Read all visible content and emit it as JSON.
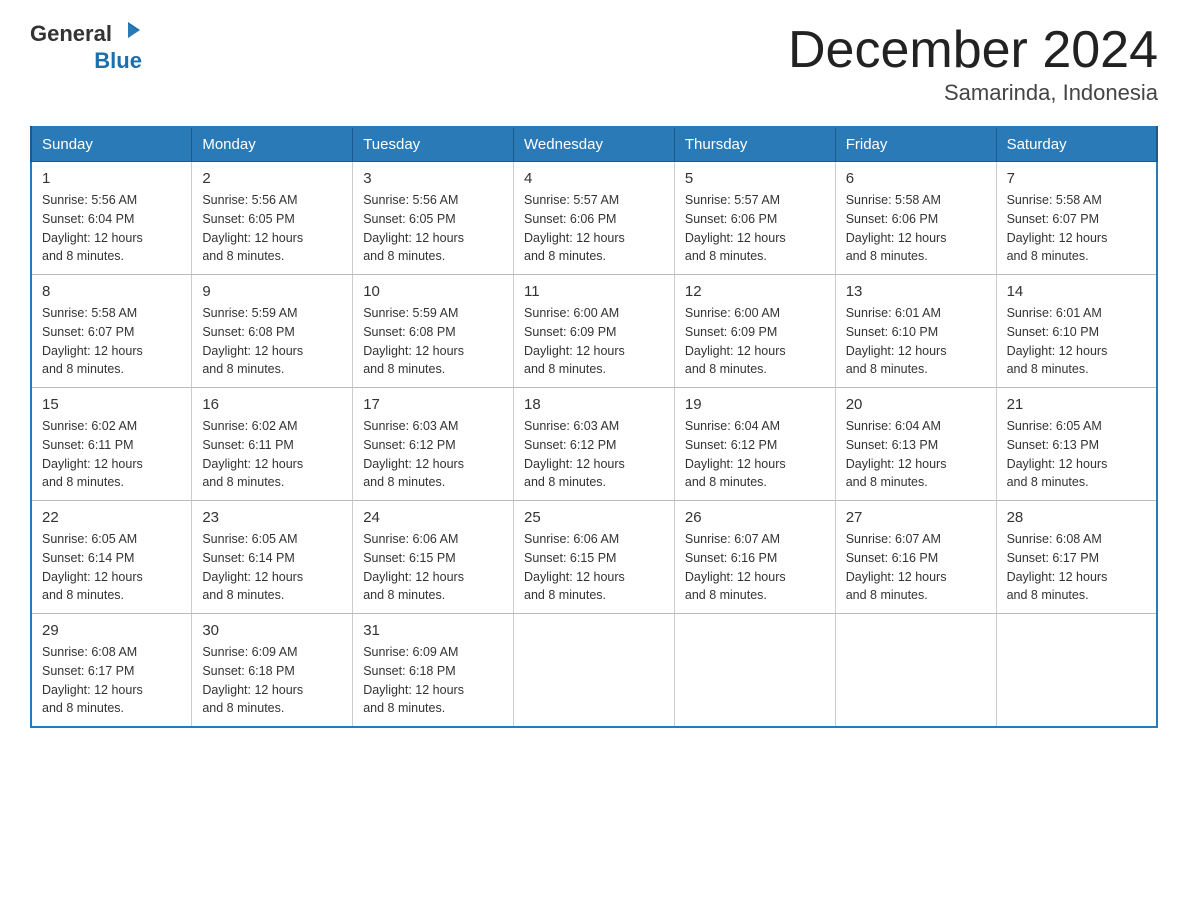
{
  "header": {
    "logo_general": "General",
    "logo_blue": "Blue",
    "title": "December 2024",
    "location": "Samarinda, Indonesia"
  },
  "days_of_week": [
    "Sunday",
    "Monday",
    "Tuesday",
    "Wednesday",
    "Thursday",
    "Friday",
    "Saturday"
  ],
  "weeks": [
    [
      {
        "num": "1",
        "sunrise": "5:56 AM",
        "sunset": "6:04 PM",
        "daylight": "12 hours and 8 minutes."
      },
      {
        "num": "2",
        "sunrise": "5:56 AM",
        "sunset": "6:05 PM",
        "daylight": "12 hours and 8 minutes."
      },
      {
        "num": "3",
        "sunrise": "5:56 AM",
        "sunset": "6:05 PM",
        "daylight": "12 hours and 8 minutes."
      },
      {
        "num": "4",
        "sunrise": "5:57 AM",
        "sunset": "6:06 PM",
        "daylight": "12 hours and 8 minutes."
      },
      {
        "num": "5",
        "sunrise": "5:57 AM",
        "sunset": "6:06 PM",
        "daylight": "12 hours and 8 minutes."
      },
      {
        "num": "6",
        "sunrise": "5:58 AM",
        "sunset": "6:06 PM",
        "daylight": "12 hours and 8 minutes."
      },
      {
        "num": "7",
        "sunrise": "5:58 AM",
        "sunset": "6:07 PM",
        "daylight": "12 hours and 8 minutes."
      }
    ],
    [
      {
        "num": "8",
        "sunrise": "5:58 AM",
        "sunset": "6:07 PM",
        "daylight": "12 hours and 8 minutes."
      },
      {
        "num": "9",
        "sunrise": "5:59 AM",
        "sunset": "6:08 PM",
        "daylight": "12 hours and 8 minutes."
      },
      {
        "num": "10",
        "sunrise": "5:59 AM",
        "sunset": "6:08 PM",
        "daylight": "12 hours and 8 minutes."
      },
      {
        "num": "11",
        "sunrise": "6:00 AM",
        "sunset": "6:09 PM",
        "daylight": "12 hours and 8 minutes."
      },
      {
        "num": "12",
        "sunrise": "6:00 AM",
        "sunset": "6:09 PM",
        "daylight": "12 hours and 8 minutes."
      },
      {
        "num": "13",
        "sunrise": "6:01 AM",
        "sunset": "6:10 PM",
        "daylight": "12 hours and 8 minutes."
      },
      {
        "num": "14",
        "sunrise": "6:01 AM",
        "sunset": "6:10 PM",
        "daylight": "12 hours and 8 minutes."
      }
    ],
    [
      {
        "num": "15",
        "sunrise": "6:02 AM",
        "sunset": "6:11 PM",
        "daylight": "12 hours and 8 minutes."
      },
      {
        "num": "16",
        "sunrise": "6:02 AM",
        "sunset": "6:11 PM",
        "daylight": "12 hours and 8 minutes."
      },
      {
        "num": "17",
        "sunrise": "6:03 AM",
        "sunset": "6:12 PM",
        "daylight": "12 hours and 8 minutes."
      },
      {
        "num": "18",
        "sunrise": "6:03 AM",
        "sunset": "6:12 PM",
        "daylight": "12 hours and 8 minutes."
      },
      {
        "num": "19",
        "sunrise": "6:04 AM",
        "sunset": "6:12 PM",
        "daylight": "12 hours and 8 minutes."
      },
      {
        "num": "20",
        "sunrise": "6:04 AM",
        "sunset": "6:13 PM",
        "daylight": "12 hours and 8 minutes."
      },
      {
        "num": "21",
        "sunrise": "6:05 AM",
        "sunset": "6:13 PM",
        "daylight": "12 hours and 8 minutes."
      }
    ],
    [
      {
        "num": "22",
        "sunrise": "6:05 AM",
        "sunset": "6:14 PM",
        "daylight": "12 hours and 8 minutes."
      },
      {
        "num": "23",
        "sunrise": "6:05 AM",
        "sunset": "6:14 PM",
        "daylight": "12 hours and 8 minutes."
      },
      {
        "num": "24",
        "sunrise": "6:06 AM",
        "sunset": "6:15 PM",
        "daylight": "12 hours and 8 minutes."
      },
      {
        "num": "25",
        "sunrise": "6:06 AM",
        "sunset": "6:15 PM",
        "daylight": "12 hours and 8 minutes."
      },
      {
        "num": "26",
        "sunrise": "6:07 AM",
        "sunset": "6:16 PM",
        "daylight": "12 hours and 8 minutes."
      },
      {
        "num": "27",
        "sunrise": "6:07 AM",
        "sunset": "6:16 PM",
        "daylight": "12 hours and 8 minutes."
      },
      {
        "num": "28",
        "sunrise": "6:08 AM",
        "sunset": "6:17 PM",
        "daylight": "12 hours and 8 minutes."
      }
    ],
    [
      {
        "num": "29",
        "sunrise": "6:08 AM",
        "sunset": "6:17 PM",
        "daylight": "12 hours and 8 minutes."
      },
      {
        "num": "30",
        "sunrise": "6:09 AM",
        "sunset": "6:18 PM",
        "daylight": "12 hours and 8 minutes."
      },
      {
        "num": "31",
        "sunrise": "6:09 AM",
        "sunset": "6:18 PM",
        "daylight": "12 hours and 8 minutes."
      },
      null,
      null,
      null,
      null
    ]
  ],
  "labels": {
    "sunrise_prefix": "Sunrise: ",
    "sunset_prefix": "Sunset: ",
    "daylight_prefix": "Daylight: "
  }
}
